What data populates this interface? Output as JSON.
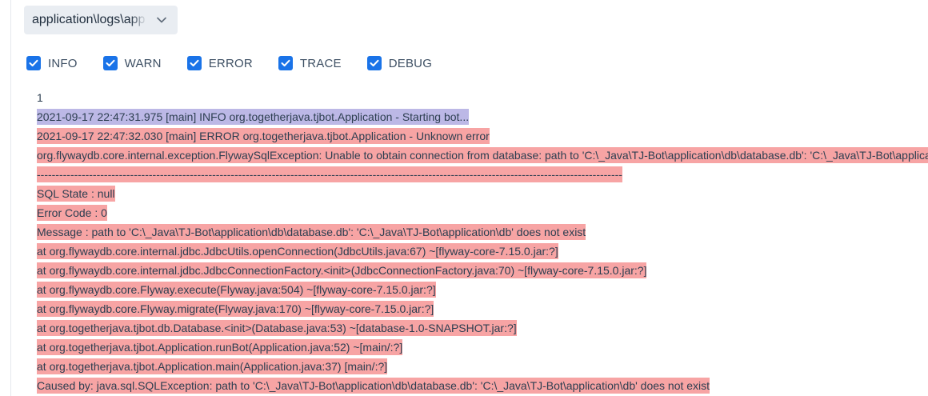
{
  "file_select": {
    "value": "application\\logs\\application.log",
    "icon": "chevron-down-icon"
  },
  "filters": [
    {
      "label": "INFO",
      "checked": true
    },
    {
      "label": "WARN",
      "checked": true
    },
    {
      "label": "ERROR",
      "checked": true
    },
    {
      "label": "TRACE",
      "checked": true
    },
    {
      "label": "DEBUG",
      "checked": true
    }
  ],
  "colors": {
    "checkbox": "#1a73e8",
    "info_highlight": "#bcb8e6",
    "error_highlight": "#f7a4a4"
  },
  "log": {
    "line_number": "1",
    "lines": [
      {
        "level": "info",
        "text": "2021-09-17 22:47:31.975 [main] INFO org.togetherjava.tjbot.Application - Starting bot..."
      },
      {
        "level": "error",
        "text": "2021-09-17 22:47:32.030 [main] ERROR org.togetherjava.tjbot.Application - Unknown error"
      },
      {
        "level": "error",
        "text": "org.flywaydb.core.internal.exception.FlywaySqlException: Unable to obtain connection from database: path to 'C:\\_Java\\TJ-Bot\\application\\db\\database.db': 'C:\\_Java\\TJ-Bot\\application\\db' does not exist"
      },
      {
        "level": "error",
        "text": "-------------------------------------------------------------------------------------------------------------------------------------------------------------"
      },
      {
        "level": "error",
        "text": "SQL State : null"
      },
      {
        "level": "error",
        "text": "Error Code : 0"
      },
      {
        "level": "error",
        "text": "Message : path to 'C:\\_Java\\TJ-Bot\\application\\db\\database.db': 'C:\\_Java\\TJ-Bot\\application\\db' does not exist"
      },
      {
        "level": "error",
        "text": "at org.flywaydb.core.internal.jdbc.JdbcUtils.openConnection(JdbcUtils.java:67) ~[flyway-core-7.15.0.jar:?]"
      },
      {
        "level": "error",
        "text": "at org.flywaydb.core.internal.jdbc.JdbcConnectionFactory.<init>(JdbcConnectionFactory.java:70) ~[flyway-core-7.15.0.jar:?]"
      },
      {
        "level": "error",
        "text": "at org.flywaydb.core.Flyway.execute(Flyway.java:504) ~[flyway-core-7.15.0.jar:?]"
      },
      {
        "level": "error",
        "text": "at org.flywaydb.core.Flyway.migrate(Flyway.java:170) ~[flyway-core-7.15.0.jar:?]"
      },
      {
        "level": "error",
        "text": "at org.togetherjava.tjbot.db.Database.<init>(Database.java:53) ~[database-1.0-SNAPSHOT.jar:?]"
      },
      {
        "level": "error",
        "text": "at org.togetherjava.tjbot.Application.runBot(Application.java:52) ~[main/:?]"
      },
      {
        "level": "error",
        "text": "at org.togetherjava.tjbot.Application.main(Application.java:37) [main/:?]"
      },
      {
        "level": "error",
        "text": "Caused by: java.sql.SQLException: path to 'C:\\_Java\\TJ-Bot\\application\\db\\database.db': 'C:\\_Java\\TJ-Bot\\application\\db' does not exist"
      }
    ]
  }
}
